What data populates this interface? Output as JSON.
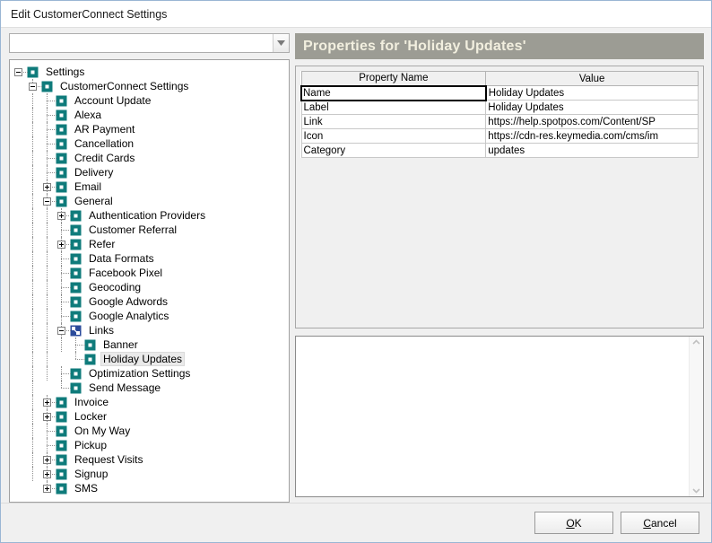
{
  "window": {
    "title": "Edit CustomerConnect Settings"
  },
  "filter": {
    "value": "",
    "placeholder": ""
  },
  "tree": {
    "nodes": [
      {
        "label": "Settings",
        "depth": 0,
        "expander": "minus",
        "icon": "teal-square-icon",
        "selected": false
      },
      {
        "label": "CustomerConnect Settings",
        "depth": 1,
        "expander": "minus",
        "icon": "teal-square-icon",
        "selected": false
      },
      {
        "label": "Account Update",
        "depth": 2,
        "expander": "none",
        "icon": "teal-square-icon",
        "selected": false
      },
      {
        "label": "Alexa",
        "depth": 2,
        "expander": "none",
        "icon": "teal-square-icon",
        "selected": false
      },
      {
        "label": "AR Payment",
        "depth": 2,
        "expander": "none",
        "icon": "teal-square-icon",
        "selected": false
      },
      {
        "label": "Cancellation",
        "depth": 2,
        "expander": "none",
        "icon": "teal-square-icon",
        "selected": false
      },
      {
        "label": "Credit Cards",
        "depth": 2,
        "expander": "none",
        "icon": "teal-square-icon",
        "selected": false
      },
      {
        "label": "Delivery",
        "depth": 2,
        "expander": "none",
        "icon": "teal-square-icon",
        "selected": false
      },
      {
        "label": "Email",
        "depth": 2,
        "expander": "plus",
        "icon": "teal-square-icon",
        "selected": false
      },
      {
        "label": "General",
        "depth": 2,
        "expander": "minus",
        "icon": "teal-square-icon",
        "selected": false
      },
      {
        "label": "Authentication Providers",
        "depth": 3,
        "expander": "plus",
        "icon": "teal-square-icon",
        "selected": false
      },
      {
        "label": "Customer Referral",
        "depth": 3,
        "expander": "none",
        "icon": "teal-square-icon",
        "selected": false
      },
      {
        "label": "Refer",
        "depth": 3,
        "expander": "plus",
        "icon": "teal-square-icon",
        "selected": false
      },
      {
        "label": "Data Formats",
        "depth": 3,
        "expander": "none",
        "icon": "teal-square-icon",
        "selected": false
      },
      {
        "label": "Facebook Pixel",
        "depth": 3,
        "expander": "none",
        "icon": "teal-square-icon",
        "selected": false
      },
      {
        "label": "Geocoding",
        "depth": 3,
        "expander": "none",
        "icon": "teal-square-icon",
        "selected": false
      },
      {
        "label": "Google Adwords",
        "depth": 3,
        "expander": "none",
        "icon": "teal-square-icon",
        "selected": false
      },
      {
        "label": "Google Analytics",
        "depth": 3,
        "expander": "none",
        "icon": "teal-square-icon",
        "selected": false
      },
      {
        "label": "Links",
        "depth": 3,
        "expander": "minus",
        "icon": "blue-links-icon",
        "selected": false
      },
      {
        "label": "Banner",
        "depth": 4,
        "expander": "none",
        "icon": "teal-square-icon",
        "selected": false
      },
      {
        "label": "Holiday Updates",
        "depth": 4,
        "expander": "none",
        "icon": "teal-square-icon",
        "selected": true
      },
      {
        "label": "Optimization Settings",
        "depth": 3,
        "expander": "none",
        "icon": "teal-square-icon",
        "selected": false
      },
      {
        "label": "Send Message",
        "depth": 3,
        "expander": "none",
        "icon": "teal-square-icon",
        "selected": false
      },
      {
        "label": "Invoice",
        "depth": 2,
        "expander": "plus",
        "icon": "teal-square-icon",
        "selected": false
      },
      {
        "label": "Locker",
        "depth": 2,
        "expander": "plus",
        "icon": "teal-square-icon",
        "selected": false
      },
      {
        "label": "On My Way",
        "depth": 2,
        "expander": "none",
        "icon": "teal-square-icon",
        "selected": false
      },
      {
        "label": "Pickup",
        "depth": 2,
        "expander": "none",
        "icon": "teal-square-icon",
        "selected": false
      },
      {
        "label": "Request Visits",
        "depth": 2,
        "expander": "plus",
        "icon": "teal-square-icon",
        "selected": false
      },
      {
        "label": "Signup",
        "depth": 2,
        "expander": "plus",
        "icon": "teal-square-icon",
        "selected": false
      },
      {
        "label": "SMS",
        "depth": 2,
        "expander": "plus",
        "icon": "teal-square-icon",
        "selected": false
      }
    ]
  },
  "properties": {
    "header": "Properties for 'Holiday Updates'",
    "columns": [
      "Property Name",
      "Value"
    ],
    "rows": [
      {
        "name": "Name",
        "value": "Holiday Updates",
        "focused": true
      },
      {
        "name": "Label",
        "value": "Holiday Updates",
        "focused": false
      },
      {
        "name": "Link",
        "value": "https://help.spotpos.com/Content/SP",
        "focused": false
      },
      {
        "name": "Icon",
        "value": "https://cdn-res.keymedia.com/cms/im",
        "focused": false
      },
      {
        "name": "Category",
        "value": "updates",
        "focused": false
      }
    ]
  },
  "notes": {
    "value": "",
    "placeholder": ""
  },
  "footer": {
    "ok_label": "OK",
    "ok_mnemonic": "O",
    "ok_rest": "K",
    "cancel_label": "Cancel",
    "cancel_mnemonic": "C",
    "cancel_rest": "ancel"
  },
  "colors": {
    "header_bg": "#9c9c94",
    "header_text": "#f2efdf",
    "node_icon_teal": "#0f7b7b",
    "node_icon_blue": "#2b4b9b",
    "selection_bg": "#eaeaea"
  }
}
